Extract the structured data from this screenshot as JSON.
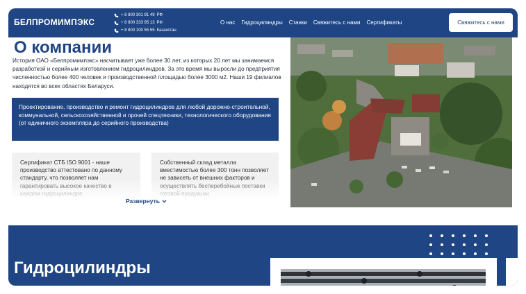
{
  "header": {
    "logo": "БЕЛПРОМИМПЭКС",
    "phones": [
      {
        "number": "+ 8 800 301 91 49",
        "country": "РФ"
      },
      {
        "number": "+ 8 800 333 95 13",
        "country": "РФ"
      },
      {
        "number": "+ 8 800 100 55 55",
        "country": "Казахстан"
      }
    ],
    "nav": [
      "О нас",
      "Гидроцилиндры",
      "Станки",
      "Свяжитесь с нами",
      "Сертификаты"
    ],
    "cta_label": "Свяжитесь с нами",
    "accent_color": "#1f4584"
  },
  "about": {
    "title": "О компании",
    "text": "История ОАО «Белпромимпэкс» насчитывает уже более 30 лет, из которых 20 лет мы занимаемся разработкой и серийным изготовлением гидроцилиндров. За это время мы выросли до предприятия численностью более 400 человек и производственной площадью более 3000 м2. Наши 19 филиалов находятся во всех областях Беларуси.",
    "highlight": "Проектирование, производство и ремонт гидроцилиндров для любой дорожно-строительной, коммунальной, сельскохозяйственной и прочей спецтехники, технологического оборудования (от единичного экземпляра до серийного производства)",
    "cards": [
      "Сертификат СТБ ISO 9001 - наше производство аттестовано по данному стандарту, что позволяет нам гарантировать высокое качество в каждом гидроцилиндре",
      "Собственный склад металла вместимостью более 300 тонн позволяет не зависеть от внешних факторов и осуществлять бесперебойные поставки готовой продукции"
    ],
    "expand_label": "Развернуть"
  },
  "hydraulics": {
    "title": "Гидроцилиндры"
  }
}
